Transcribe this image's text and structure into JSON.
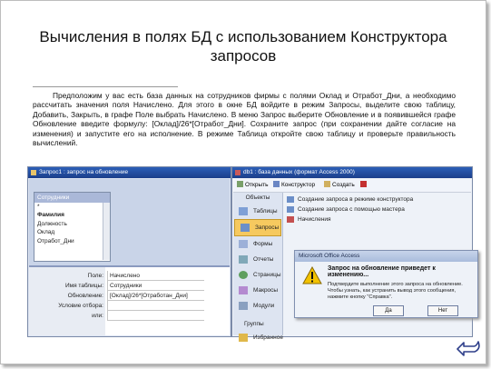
{
  "title": "Вычисления в полях БД с использованием Конструктора запросов",
  "paragraph": "Предположим у вас есть база данных на сотрудников фирмы с полями Оклад и Отработ_Дни, а необходимо рассчитать значения поля Начислено. Для этого в окне БД войдите в режим Запросы, выделите свою таблицу, Добавить, Закрыть, в графе Поле выбрать Начислено. В меню Запрос выберите Обновление и в появившейся графе Обновление введите формулу: [Оклад]/26*[Отработ_Дни]. Сохраните запрос (при сохранении дайте согласие на изменения) и запустите его на исполнение. В режиме Таблица откройте свою таблицу и проверьте правильность вычислений.",
  "query_window": {
    "title": "Запрос1 : запрос на обновление",
    "table": {
      "name": "Сотрудники",
      "fields": [
        "*",
        "Фамилия",
        "Должность",
        "Оклад",
        "Отработ_Дни"
      ]
    },
    "grid": [
      {
        "label": "Поле:",
        "value": "Начислено"
      },
      {
        "label": "Имя таблицы:",
        "value": "Сотрудники"
      },
      {
        "label": "Обновление:",
        "value": "[Оклад]/26*[Отработан_Дни]"
      },
      {
        "label": "Условие отбора:",
        "value": ""
      },
      {
        "label": "или:",
        "value": ""
      }
    ]
  },
  "db_window": {
    "title": "db1 : база данных (формат Access 2000)",
    "toolbar": {
      "open": "Открыть",
      "design": "Конструктор",
      "create": "Создать"
    },
    "nav_header": "Объекты",
    "nav": [
      "Таблицы",
      "Запросы",
      "Формы",
      "Отчеты",
      "Страницы",
      "Макросы",
      "Модули"
    ],
    "nav_selected": "Запросы",
    "groups": "Группы",
    "favorites": "Избранное",
    "objects": [
      "Создание запроса в режиме конструктора",
      "Создание запроса с помощью мастера",
      "Начисления"
    ]
  },
  "dialog": {
    "title": "Microsoft Office Access",
    "heading": "Запрос на обновление приведет к изменению...",
    "message": "Подтвердите выполнение этого запроса на обновление. Чтобы узнать, как устранить вывод этого сообщения, нажмите кнопку \"Справка\".",
    "yes": "Да",
    "no": "Нет"
  },
  "colors": {
    "accent": "#2c5fb8",
    "selected_nav": "#f6c95f",
    "warning": "#f2c200"
  },
  "icons": {
    "back": "return-arrow-icon",
    "warning": "warning-icon"
  }
}
